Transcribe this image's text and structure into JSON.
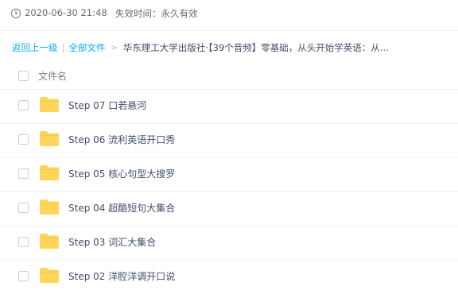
{
  "meta": {
    "share_date": "2020-06-30 21:48",
    "expiry": "失效时间：永久有效"
  },
  "breadcrumb": {
    "back": "返回上一级",
    "separator": "|",
    "all_files": "全部文件",
    "arrow": ">",
    "current": "华东理工大学出版社·【39个音频】零基础，从头开始学英语：从..."
  },
  "list": {
    "header_label": "文件名",
    "files": [
      {
        "name": "Step 07 口若悬河"
      },
      {
        "name": "Step 06 流利英语开口秀"
      },
      {
        "name": "Step 05 核心句型大搜罗"
      },
      {
        "name": "Step 04 超酷短句大集合"
      },
      {
        "name": "Step 03 词汇大集合"
      },
      {
        "name": "Step 02 洋腔洋调开口说"
      }
    ]
  },
  "colors": {
    "link": "#09aaff",
    "folder": "#ffd659",
    "text": "#424e67"
  },
  "icons": {
    "clock": "clock-icon",
    "folder": "folder-icon"
  }
}
